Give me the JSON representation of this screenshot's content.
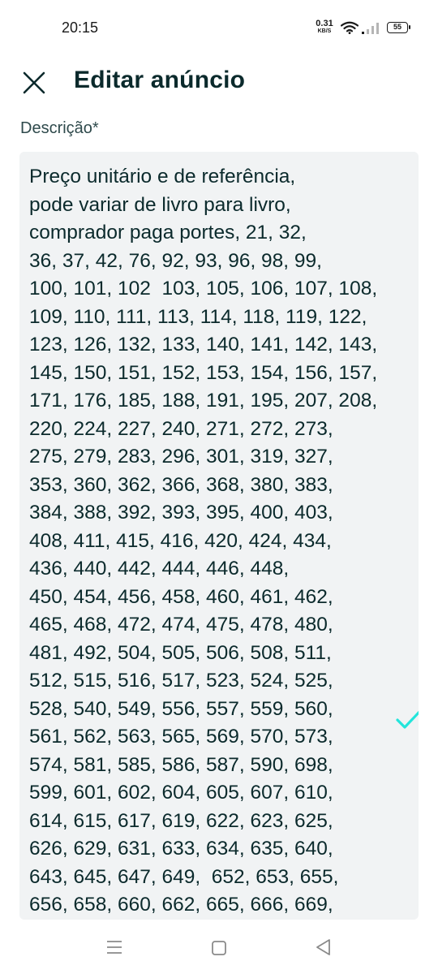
{
  "status_bar": {
    "time": "20:15",
    "net_speed_value": "0.31",
    "net_speed_unit": "KB/S",
    "battery": "55",
    "icons": [
      "wifi-icon",
      "signal-icon",
      "battery-icon"
    ]
  },
  "header": {
    "close_icon": "close-icon",
    "title": "Editar anúncio"
  },
  "field": {
    "label": "Descrição*",
    "value": "Preço unitário e de referência,\npode variar de livro para livro,\ncomprador paga portes, 21, 32,\n36, 37, 42, 76, 92, 93, 96, 98, 99,\n100, 101, 102  103, 105, 106, 107, 108,\n109, 110, 111, 113, 114, 118, 119, 122,\n123, 126, 132, 133, 140, 141, 142, 143,\n145, 150, 151, 152, 153, 154, 156, 157,\n171, 176, 185, 188, 191, 195, 207, 208,\n220, 224, 227, 240, 271, 272, 273,\n275, 279, 283, 296, 301, 319, 327,\n353, 360, 362, 366, 368, 380, 383,\n384, 388, 392, 393, 395, 400, 403,\n408, 411, 415, 416, 420, 424, 434,\n436, 440, 442, 444, 446, 448,\n450, 454, 456, 458, 460, 461, 462,\n465, 468, 472, 474, 475, 478, 480,\n481, 492, 504, 505, 506, 508, 511,\n512, 515, 516, 517, 523, 524, 525,\n528, 540, 549, 556, 557, 559, 560,\n561, 562, 563, 565, 569, 570, 573,\n574, 581, 585, 586, 587, 590, 698,\n599, 601, 602, 604, 605, 607, 610,\n614, 615, 617, 619, 622, 623, 625,\n626, 629, 631, 633, 634, 635, 640,\n643, 645, 647, 649,  652, 653, 655,\n656, 658, 660, 662, 665, 666, 669,",
    "valid_icon": "check-icon"
  },
  "nav_bar": {
    "icons": [
      "menu-icon",
      "home-icon",
      "back-icon"
    ]
  },
  "colors": {
    "text_dark": "#0b2a2c",
    "field_bg": "#f1f3f4",
    "accent_check": "#23e5db"
  }
}
